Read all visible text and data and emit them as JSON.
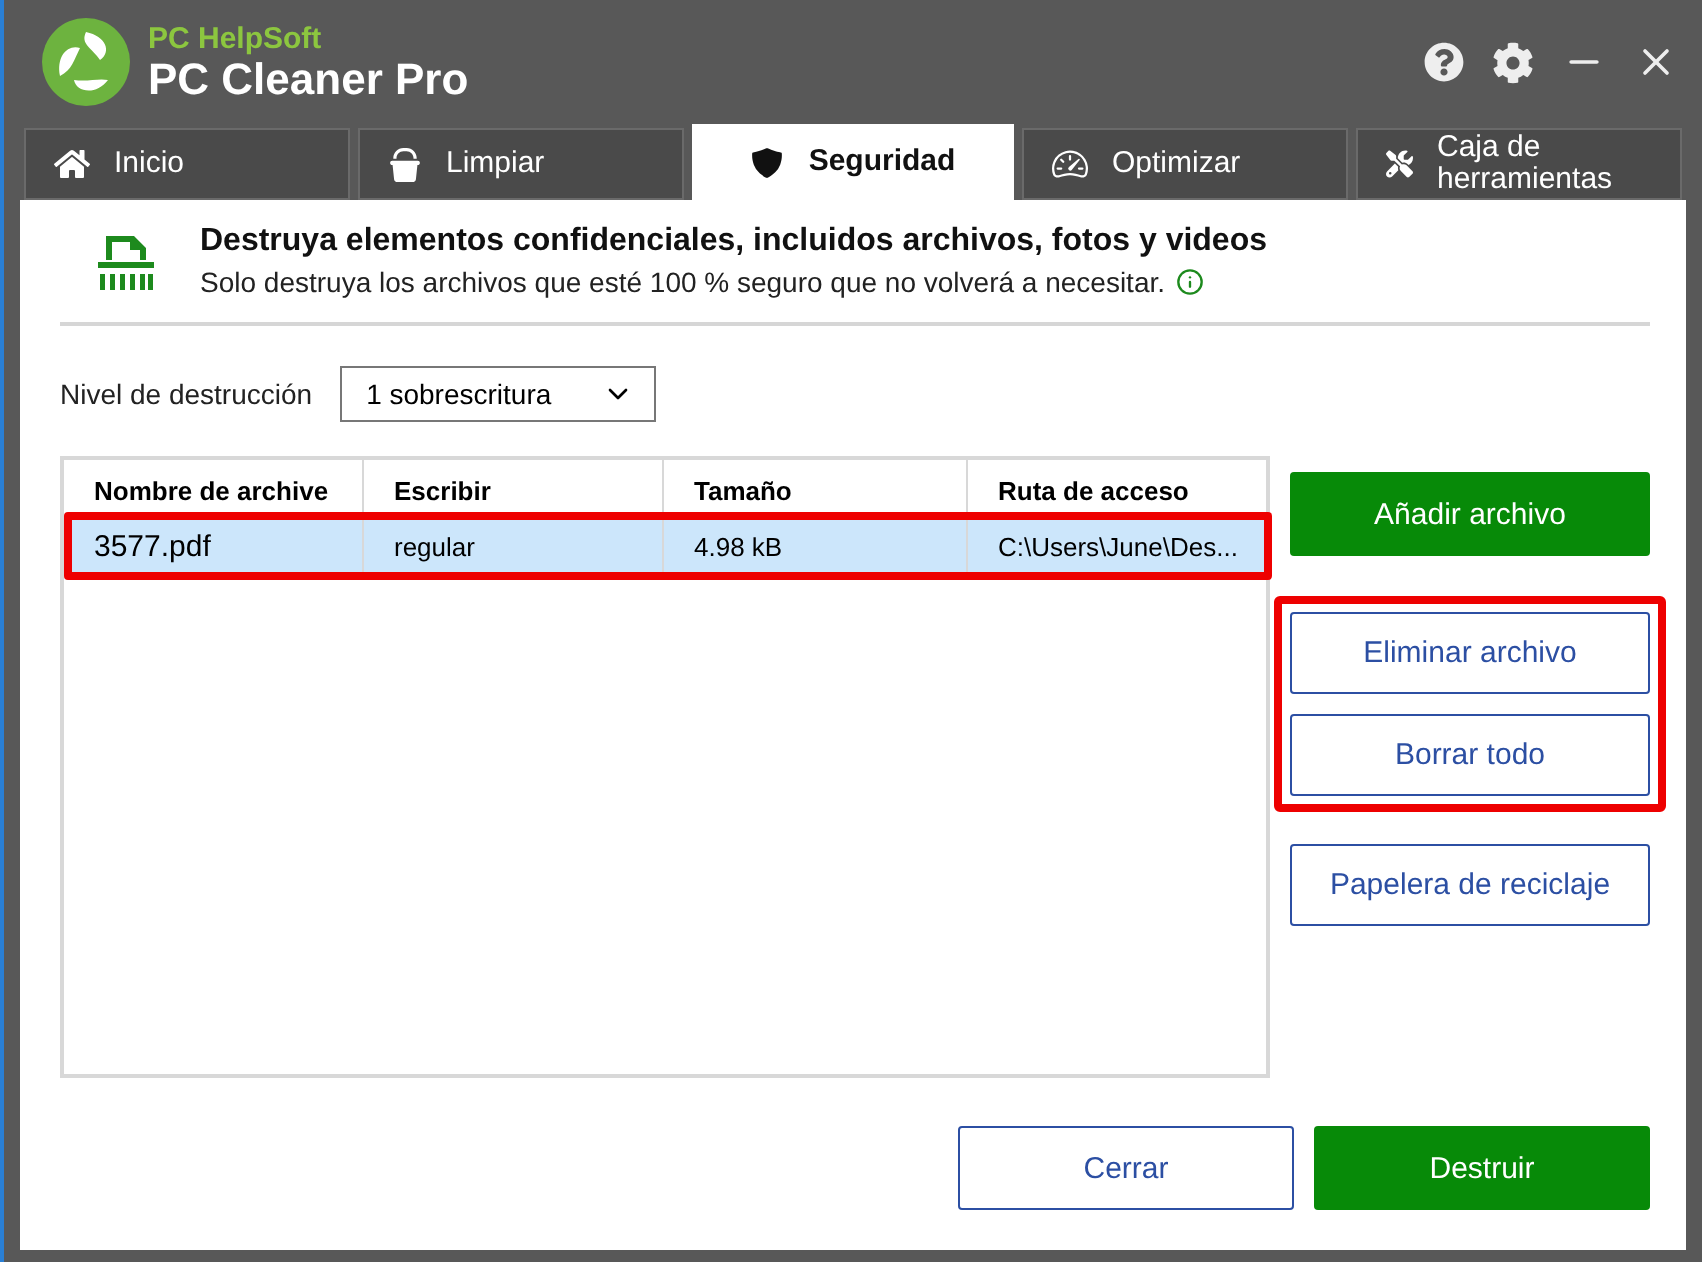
{
  "window": {
    "brand": "PC HelpSoft",
    "title": "PC Cleaner Pro"
  },
  "tabs": [
    {
      "label": "Inicio",
      "kind": "home",
      "selected": false
    },
    {
      "label": "Limpiar",
      "kind": "clean",
      "selected": false
    },
    {
      "label": "Seguridad",
      "kind": "shield",
      "selected": true
    },
    {
      "label": "Optimizar",
      "kind": "gauge",
      "selected": false
    },
    {
      "label": "Caja de herramientas",
      "kind": "tools",
      "selected": false
    }
  ],
  "header": {
    "title": "Destruya elementos confidenciales, incluidos archivos, fotos y videos",
    "subtitle": "Solo destruya los archivos que esté 100 % seguro que no volverá a necesitar."
  },
  "level": {
    "label": "Nivel de destrucción",
    "value": "1 sobrescritura"
  },
  "table": {
    "columns": [
      "Nombre de archive",
      "Escribir",
      "Tamaño",
      "Ruta de acceso"
    ],
    "rows": [
      {
        "cells": [
          "3577.pdf",
          "regular",
          "4.98 kB",
          "C:\\Users\\June\\Des..."
        ],
        "selected": true,
        "highlighted": true
      }
    ]
  },
  "side_button_groups": [
    {
      "highlighted": false,
      "buttons": [
        {
          "label": "Añadir archivo",
          "kind": "primary"
        }
      ]
    },
    {
      "highlighted": true,
      "buttons": [
        {
          "label": "Eliminar archivo",
          "kind": "outline"
        },
        {
          "label": "Borrar todo",
          "kind": "outline"
        }
      ]
    },
    {
      "highlighted": false,
      "buttons": [
        {
          "label": "Papelera de reciclaje",
          "kind": "outline"
        }
      ]
    }
  ],
  "footer_buttons": [
    {
      "label": "Cerrar",
      "kind": "outline"
    },
    {
      "label": "Destruir",
      "kind": "primary"
    }
  ]
}
